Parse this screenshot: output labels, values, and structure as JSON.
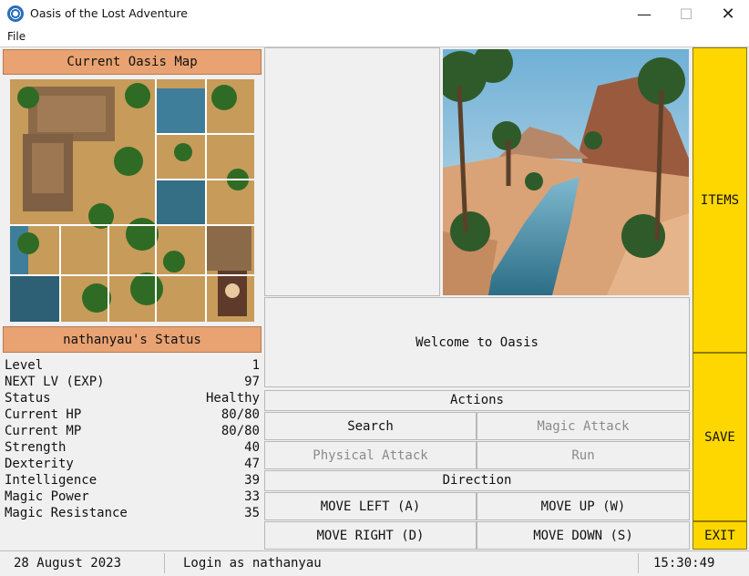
{
  "window": {
    "title": "Oasis of the Lost Adventure",
    "icon": "globe-gear-icon",
    "minimize": "—",
    "maximize": "☐",
    "close": "✕"
  },
  "menu": {
    "file": "File"
  },
  "map": {
    "header": "Current Oasis Map"
  },
  "status": {
    "header": "nathanyau's Status",
    "rows": [
      {
        "label": "Level",
        "value": "1"
      },
      {
        "label": "NEXT LV (EXP)",
        "value": "97"
      },
      {
        "label": "Status",
        "value": "Healthy"
      },
      {
        "label": "Current HP",
        "value": "80/80"
      },
      {
        "label": "Current MP",
        "value": "80/80"
      },
      {
        "label": "Strength",
        "value": "40"
      },
      {
        "label": "Dexterity",
        "value": "47"
      },
      {
        "label": "Intelligence",
        "value": "39"
      },
      {
        "label": "Magic Power",
        "value": "33"
      },
      {
        "label": "Magic Resistance",
        "value": "35"
      }
    ]
  },
  "message": "Welcome to Oasis",
  "actions": {
    "header": "Actions",
    "search": "Search",
    "magic_attack": "Magic Attack",
    "physical_attack": "Physical Attack",
    "run": "Run"
  },
  "direction": {
    "header": "Direction",
    "left": "MOVE LEFT (A)",
    "up": "MOVE UP (W)",
    "right": "MOVE RIGHT (D)",
    "down": "MOVE DOWN (S)"
  },
  "side": {
    "items": "ITEMS",
    "save": "SAVE",
    "exit": "EXIT"
  },
  "statusbar": {
    "date": "28 August 2023",
    "login": "Login as nathanyau",
    "time": "15:30:49"
  },
  "colors": {
    "salmon": "#e9a271",
    "yellow": "#ffd700",
    "background": "#f0f0f0"
  }
}
